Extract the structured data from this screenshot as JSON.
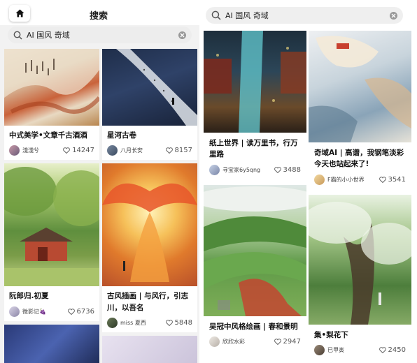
{
  "left_panel": {
    "title": "搜索",
    "search": {
      "query": "AI 国风  奇域"
    },
    "columns": [
      [
        {
          "title": "中式美学•文章千古酒酒",
          "author": "淺淺兮",
          "likes": "14247"
        },
        {
          "title": "阮郎归.初夏",
          "author": "微影记🍇",
          "likes": "6736"
        }
      ],
      [
        {
          "title": "星河古卷",
          "author": "八月长安",
          "likes": "8157"
        },
        {
          "title": "古风插画 | 与风行，引志川，以吾名",
          "author": "miss 夏西",
          "likes": "5848"
        }
      ]
    ]
  },
  "right_panel": {
    "search": {
      "query": "AI 国风  奇域"
    },
    "columns": [
      [
        {
          "title": "纸上世界 | 读万里书，行万里路",
          "author": "寻宝家6y5qng",
          "likes": "3488"
        },
        {
          "title": "吴冠中风格绘画 | 春和景明",
          "author": "欣欣水彩",
          "likes": "2947"
        }
      ],
      [
        {
          "title": "奇域AI | 高谱，我钢笔淡彩今天也站起来了!",
          "author": "F霸的小小世界",
          "likes": "3541"
        },
        {
          "title": "集•梨花下",
          "author": "已甲寅",
          "likes": "2450"
        }
      ]
    ]
  },
  "colors": {
    "title": "#222222",
    "search_bg": "#efefef",
    "like_icon": "#666666"
  }
}
